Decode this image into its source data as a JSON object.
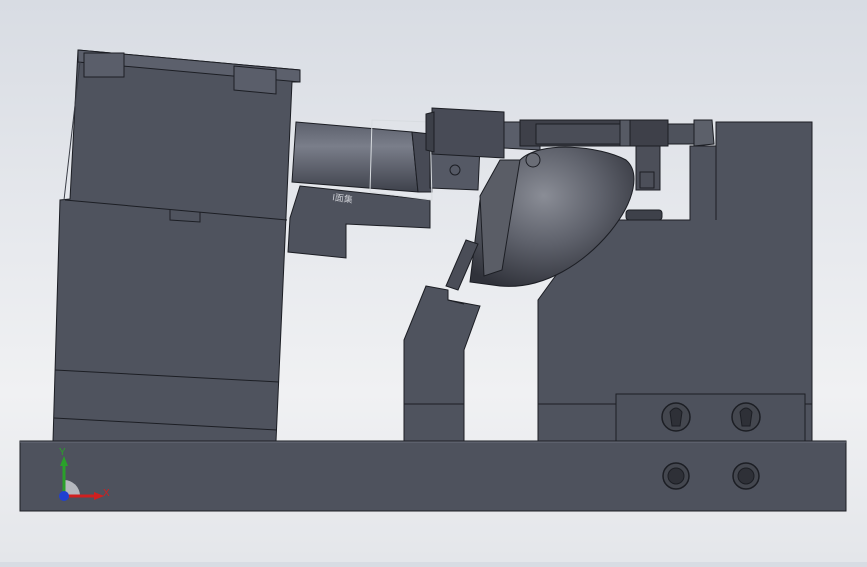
{
  "viewport": {
    "background": "#e6e8ec"
  },
  "model": {
    "body_color": "#505460",
    "edge_color": "#1c1e24",
    "highlight_color": "#6a6e7a",
    "engraved_text": "I面集"
  },
  "triad": {
    "y_label": "Y",
    "x_label": "X",
    "y_color": "#2aa02a",
    "x_color": "#d02020",
    "z_color": "#2040d0"
  }
}
